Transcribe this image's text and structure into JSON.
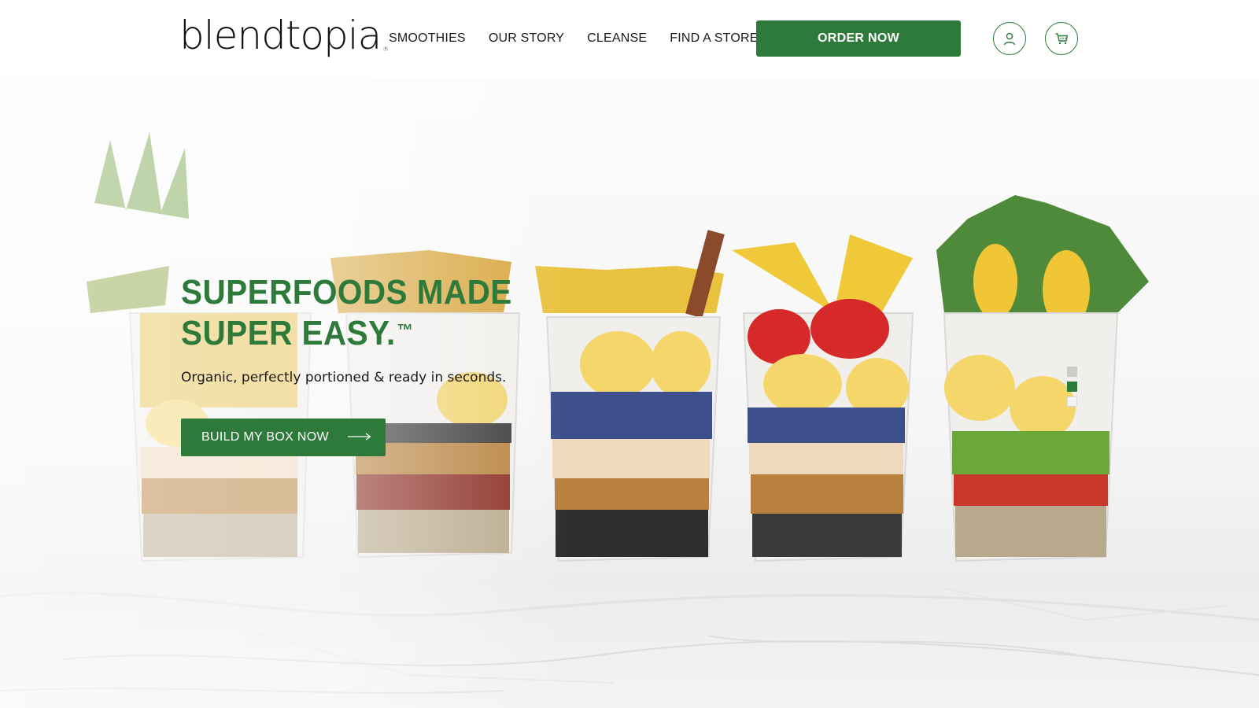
{
  "brand": {
    "name": "blendtopia",
    "registered_mark": "®"
  },
  "nav": {
    "items": [
      {
        "label": "SMOOTHIES"
      },
      {
        "label": "OUR STORY"
      },
      {
        "label": "CLEANSE"
      },
      {
        "label": "FIND A STORE"
      }
    ],
    "order_label": "ORDER NOW",
    "account_icon": "user-icon",
    "cart_icon": "cart-icon"
  },
  "hero": {
    "headline_line1": "SUPERFOODS MADE",
    "headline_line2": "SUPER EASY.",
    "trademark": "™",
    "subhead": "Organic, perfectly portioned & ready in seconds.",
    "cta_label": "BUILD MY BOX NOW",
    "cta_icon": "arrow-right-icon",
    "slides": {
      "total": 3,
      "active_index": 1
    }
  },
  "colors": {
    "brand_green": "#2d7a3a",
    "text_dark": "#1a1a1a"
  }
}
